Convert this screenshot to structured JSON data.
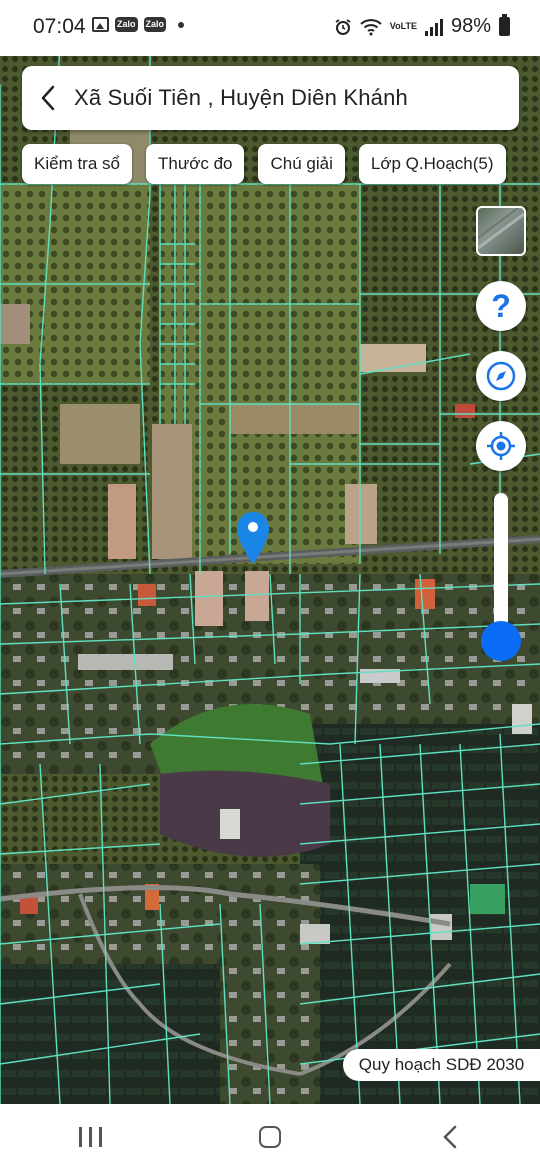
{
  "status_bar": {
    "time": "07:04",
    "left_icons": [
      "photo-icon",
      "zalo-icon",
      "zalo-icon",
      "dot-icon"
    ],
    "zalo_label": "Zalo",
    "lte_label": "VoLTE",
    "battery": "98%"
  },
  "header": {
    "title": "Xã Suối Tiên , Huyện Diên Khánh"
  },
  "chips": [
    {
      "label": "Kiểm tra sổ"
    },
    {
      "label": "Thước đo"
    },
    {
      "label": "Chú giải"
    },
    {
      "label": "Lớp Q.Hoạch(5)"
    }
  ],
  "map": {
    "help_symbol": "?",
    "layer_opacity": 0.05,
    "plan_badge": "Quy hoạch SDĐ 2030",
    "parcel_line_color": "#5fe0c0",
    "accent_color": "#1a73e8"
  }
}
